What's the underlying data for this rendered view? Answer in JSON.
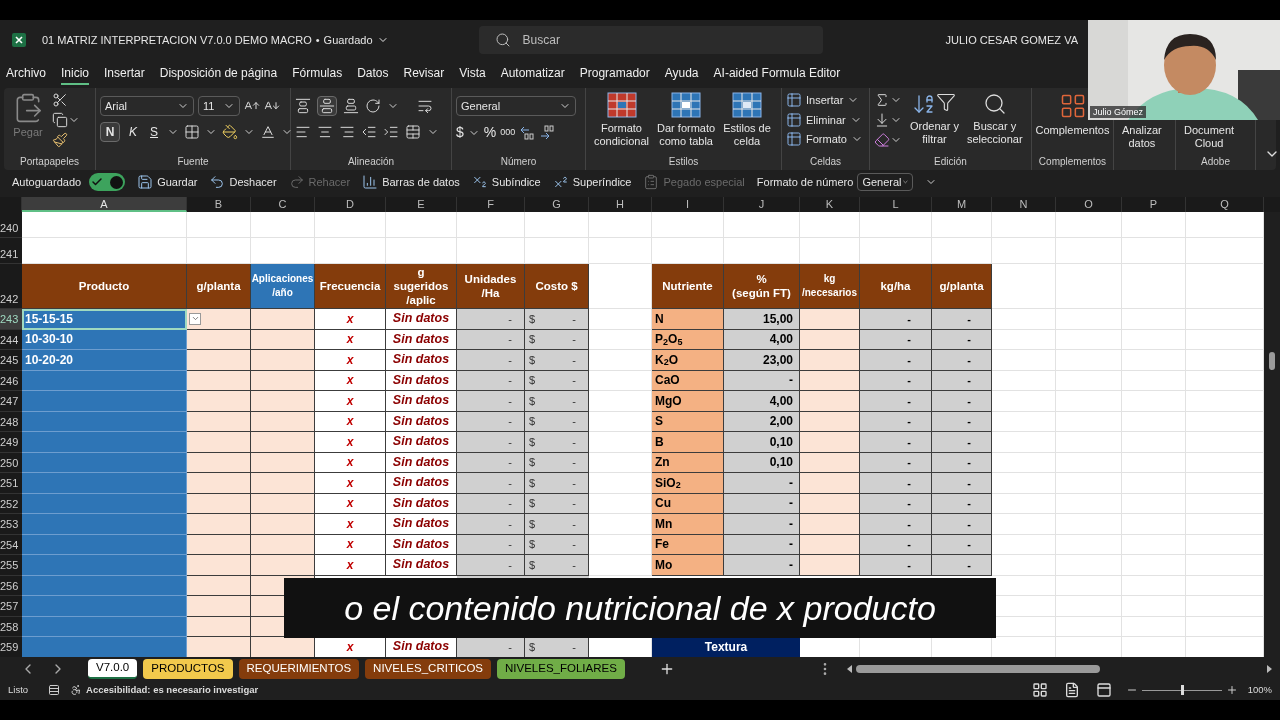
{
  "title_bar": {
    "file_name": "01 MATRIZ INTERPRETACION V7.0.0 DEMO MACRO",
    "separator": "•",
    "save_status": "Guardado",
    "search_placeholder": "Buscar",
    "user": "JULIO CESAR GOMEZ VA"
  },
  "menu_tabs": [
    {
      "label": "Archivo",
      "selected": false
    },
    {
      "label": "Inicio",
      "selected": true
    },
    {
      "label": "Insertar",
      "selected": false
    },
    {
      "label": "Disposición de página",
      "selected": false
    },
    {
      "label": "Fórmulas",
      "selected": false
    },
    {
      "label": "Datos",
      "selected": false
    },
    {
      "label": "Revisar",
      "selected": false
    },
    {
      "label": "Vista",
      "selected": false
    },
    {
      "label": "Automatizar",
      "selected": false
    },
    {
      "label": "Programador",
      "selected": false
    },
    {
      "label": "Ayuda",
      "selected": false
    },
    {
      "label": "AI-aided Formula Editor",
      "selected": false
    }
  ],
  "ribbon": {
    "clipboard": {
      "paste": "Pegar",
      "label": "Portapapeles"
    },
    "font": {
      "family": "Arial",
      "size": "11",
      "bold": "N",
      "italic": "K",
      "underline": "S",
      "bold_on": true,
      "label": "Fuente"
    },
    "alignment": {
      "middle_on": true,
      "label": "Alineación"
    },
    "number": {
      "format": "General",
      "currency": "$",
      "percent": "%",
      "thousands": "000",
      "label": "Número"
    },
    "styles": {
      "buttons": [
        "Formato\ncondicional",
        "Dar formato\ncomo tabla",
        "Estilos de\ncelda"
      ],
      "label": "Estilos"
    },
    "cells": {
      "buttons": [
        "Insertar",
        "Eliminar",
        "Formato"
      ],
      "label": "Celdas"
    },
    "editing": {
      "buttons": [
        "Ordenar y\nfiltrar",
        "Buscar y\nseleccionar"
      ],
      "label": "Edición"
    },
    "addins": {
      "button": "Complementos",
      "label": "Complementos"
    },
    "analyze": {
      "button": "Analizar\ndatos"
    },
    "adobe": {
      "button": "Document\nCloud",
      "label": "Adobe"
    }
  },
  "quick_access": {
    "autosave": {
      "label": "Autoguardado",
      "on": true
    },
    "buttons": [
      {
        "kind": "save",
        "label": "Guardar",
        "disabled": false
      },
      {
        "kind": "undo",
        "label": "Deshacer",
        "disabled": false
      },
      {
        "kind": "redo",
        "label": "Rehacer",
        "disabled": true
      },
      {
        "kind": "databars",
        "label": "Barras de datos",
        "disabled": false
      },
      {
        "kind": "subscript",
        "label": "Subíndice",
        "disabled": false
      },
      {
        "kind": "superscript",
        "label": "Superíndice",
        "disabled": false
      },
      {
        "kind": "paste",
        "label": "Pegado especial",
        "disabled": true
      }
    ],
    "number_format": {
      "label": "Formato de número",
      "value": "General"
    }
  },
  "sheet": {
    "columns": [
      {
        "label": "A",
        "selected": true
      },
      {
        "label": "B",
        "selected": false
      },
      {
        "label": "C",
        "selected": false
      },
      {
        "label": "D",
        "selected": false
      },
      {
        "label": "E",
        "selected": false
      },
      {
        "label": "F",
        "selected": false
      },
      {
        "label": "G",
        "selected": false
      },
      {
        "label": "H",
        "selected": false
      },
      {
        "label": "I",
        "selected": false
      },
      {
        "label": "J",
        "selected": false
      },
      {
        "label": "K",
        "selected": false
      },
      {
        "label": "L",
        "selected": false
      },
      {
        "label": "M",
        "selected": false
      },
      {
        "label": "N",
        "selected": false
      },
      {
        "label": "O",
        "selected": false
      },
      {
        "label": "P",
        "selected": false
      },
      {
        "label": "Q",
        "selected": false
      }
    ],
    "left_headers": [
      {
        "label": "Producto",
        "color": "#843c0c"
      },
      {
        "label": "g/planta",
        "color": "#843c0c"
      },
      {
        "label": "Aplicaciones\n/año",
        "color": "#2e75b6"
      },
      {
        "label": "Frecuencia",
        "color": "#843c0c"
      },
      {
        "label": "g\nsugeridos\n/aplic",
        "color": "#843c0c"
      },
      {
        "label": "Unidades\n/Ha",
        "color": "#843c0c"
      },
      {
        "label": "Costo $",
        "color": "#843c0c"
      }
    ],
    "right_headers": [
      {
        "label": "Nutriente",
        "color": "#843c0c"
      },
      {
        "label": "%\n(según FT)",
        "color": "#843c0c"
      },
      {
        "label": "kg\n/necesarios",
        "color": "#843c0c"
      },
      {
        "label": "kg/ha",
        "color": "#843c0c"
      },
      {
        "label": "g/planta",
        "color": "#843c0c"
      }
    ],
    "rows": [
      {
        "number": "240",
        "kind": "blank",
        "selected": false
      },
      {
        "number": "241",
        "kind": "blank",
        "selected": false
      },
      {
        "number": "242",
        "kind": "header",
        "selected": false
      },
      {
        "number": "243",
        "kind": "data",
        "selected": true,
        "left": {
          "producto": "15-15-15",
          "frecuencia": "x",
          "sugeridos": "Sin datos",
          "unidades": "-",
          "currency": "$",
          "costo": "-"
        },
        "right": {
          "nutriente": "N",
          "percent": "15,00",
          "kg_ha": "-",
          "g_planta": "-"
        }
      },
      {
        "number": "244",
        "kind": "data",
        "selected": false,
        "left": {
          "producto": "10-30-10",
          "frecuencia": "x",
          "sugeridos": "Sin datos",
          "unidades": "-",
          "currency": "$",
          "costo": "-"
        },
        "right": {
          "nutriente": "P$_{2}$O$_{5}$",
          "percent": "4,00",
          "kg_ha": "-",
          "g_planta": "-"
        }
      },
      {
        "number": "245",
        "kind": "data",
        "selected": false,
        "left": {
          "producto": "10-20-20",
          "frecuencia": "x",
          "sugeridos": "Sin datos",
          "unidades": "-",
          "currency": "$",
          "costo": "-"
        },
        "right": {
          "nutriente": "K$_{2}$O",
          "percent": "23,00",
          "kg_ha": "-",
          "g_planta": "-"
        }
      },
      {
        "number": "246",
        "kind": "data",
        "selected": false,
        "left": {
          "frecuencia": "x",
          "sugeridos": "Sin datos",
          "unidades": "-",
          "currency": "$",
          "costo": "-"
        },
        "right": {
          "nutriente": "CaO",
          "percent": "-",
          "kg_ha": "-",
          "g_planta": "-"
        }
      },
      {
        "number": "247",
        "kind": "data",
        "selected": false,
        "left": {
          "frecuencia": "x",
          "sugeridos": "Sin datos",
          "unidades": "-",
          "currency": "$",
          "costo": "-"
        },
        "right": {
          "nutriente": "MgO",
          "percent": "4,00",
          "kg_ha": "-",
          "g_planta": "-"
        }
      },
      {
        "number": "248",
        "kind": "data",
        "selected": false,
        "left": {
          "frecuencia": "x",
          "sugeridos": "Sin datos",
          "unidades": "-",
          "currency": "$",
          "costo": "-"
        },
        "right": {
          "nutriente": "S",
          "percent": "2,00",
          "kg_ha": "-",
          "g_planta": "-"
        }
      },
      {
        "number": "249",
        "kind": "data",
        "selected": false,
        "left": {
          "frecuencia": "x",
          "sugeridos": "Sin datos",
          "unidades": "-",
          "currency": "$",
          "costo": "-"
        },
        "right": {
          "nutriente": "B",
          "percent": "0,10",
          "kg_ha": "-",
          "g_planta": "-"
        }
      },
      {
        "number": "250",
        "kind": "data",
        "selected": false,
        "left": {
          "frecuencia": "x",
          "sugeridos": "Sin datos",
          "unidades": "-",
          "currency": "$",
          "costo": "-"
        },
        "right": {
          "nutriente": "Zn",
          "percent": "0,10",
          "kg_ha": "-",
          "g_planta": "-"
        }
      },
      {
        "number": "251",
        "kind": "data",
        "selected": false,
        "left": {
          "frecuencia": "x",
          "sugeridos": "Sin datos",
          "unidades": "-",
          "currency": "$",
          "costo": "-"
        },
        "right": {
          "nutriente": "SiO$_{2}$",
          "percent": "-",
          "kg_ha": "-",
          "g_planta": "-"
        }
      },
      {
        "number": "252",
        "kind": "data",
        "selected": false,
        "left": {
          "frecuencia": "x",
          "sugeridos": "Sin datos",
          "unidades": "-",
          "currency": "$",
          "costo": "-"
        },
        "right": {
          "nutriente": "Cu",
          "percent": "-",
          "kg_ha": "-",
          "g_planta": "-"
        }
      },
      {
        "number": "253",
        "kind": "data",
        "selected": false,
        "left": {
          "frecuencia": "x",
          "sugeridos": "Sin datos",
          "unidades": "-",
          "currency": "$",
          "costo": "-"
        },
        "right": {
          "nutriente": "Mn",
          "percent": "-",
          "kg_ha": "-",
          "g_planta": "-"
        }
      },
      {
        "number": "254",
        "kind": "data",
        "selected": false,
        "left": {
          "frecuencia": "x",
          "sugeridos": "Sin datos",
          "unidades": "-",
          "currency": "$",
          "costo": "-"
        },
        "right": {
          "nutriente": "Fe",
          "percent": "-",
          "kg_ha": "-",
          "g_planta": "-"
        }
      },
      {
        "number": "255",
        "kind": "data",
        "selected": false,
        "left": {
          "frecuencia": "x",
          "sugeridos": "Sin datos",
          "unidades": "-",
          "currency": "$",
          "costo": "-"
        },
        "right": {
          "nutriente": "Mo",
          "percent": "-",
          "kg_ha": "-",
          "g_planta": "-"
        }
      },
      {
        "number": "256",
        "kind": "covered",
        "selected": false
      },
      {
        "number": "257",
        "kind": "covered",
        "selected": false
      },
      {
        "number": "258",
        "kind": "covered",
        "selected": false
      },
      {
        "number": "259",
        "kind": "last",
        "selected": false,
        "left": {
          "frecuencia": "x",
          "sugeridos": "Sin datos",
          "unidades": "-",
          "currency": "$",
          "costo": "-"
        },
        "textura": "Textura"
      }
    ]
  },
  "sheet_tabs": [
    {
      "label": "V7.0.0",
      "selected": true
    },
    {
      "label": "PRODUCTOS",
      "selected": false,
      "color": "#f2c94c"
    },
    {
      "label": "REQUERIMIENTOS",
      "selected": false,
      "color": "#843c0c"
    },
    {
      "label": "NIVELES_CRITICOS",
      "selected": false,
      "color": "#843c0c"
    },
    {
      "label": "NIVELES_FOLIARES",
      "selected": false,
      "color": "#70ad47"
    }
  ],
  "status_bar": {
    "status": "Listo",
    "accessibility": "Accesibilidad: es necesario investigar",
    "zoom": "100%",
    "zoom_slider": {
      "level": 0.5
    }
  },
  "webcam": {
    "kind": "picture",
    "name": "Julio Gómez"
  },
  "subtitle": "o el contenido nutricional de x producto"
}
